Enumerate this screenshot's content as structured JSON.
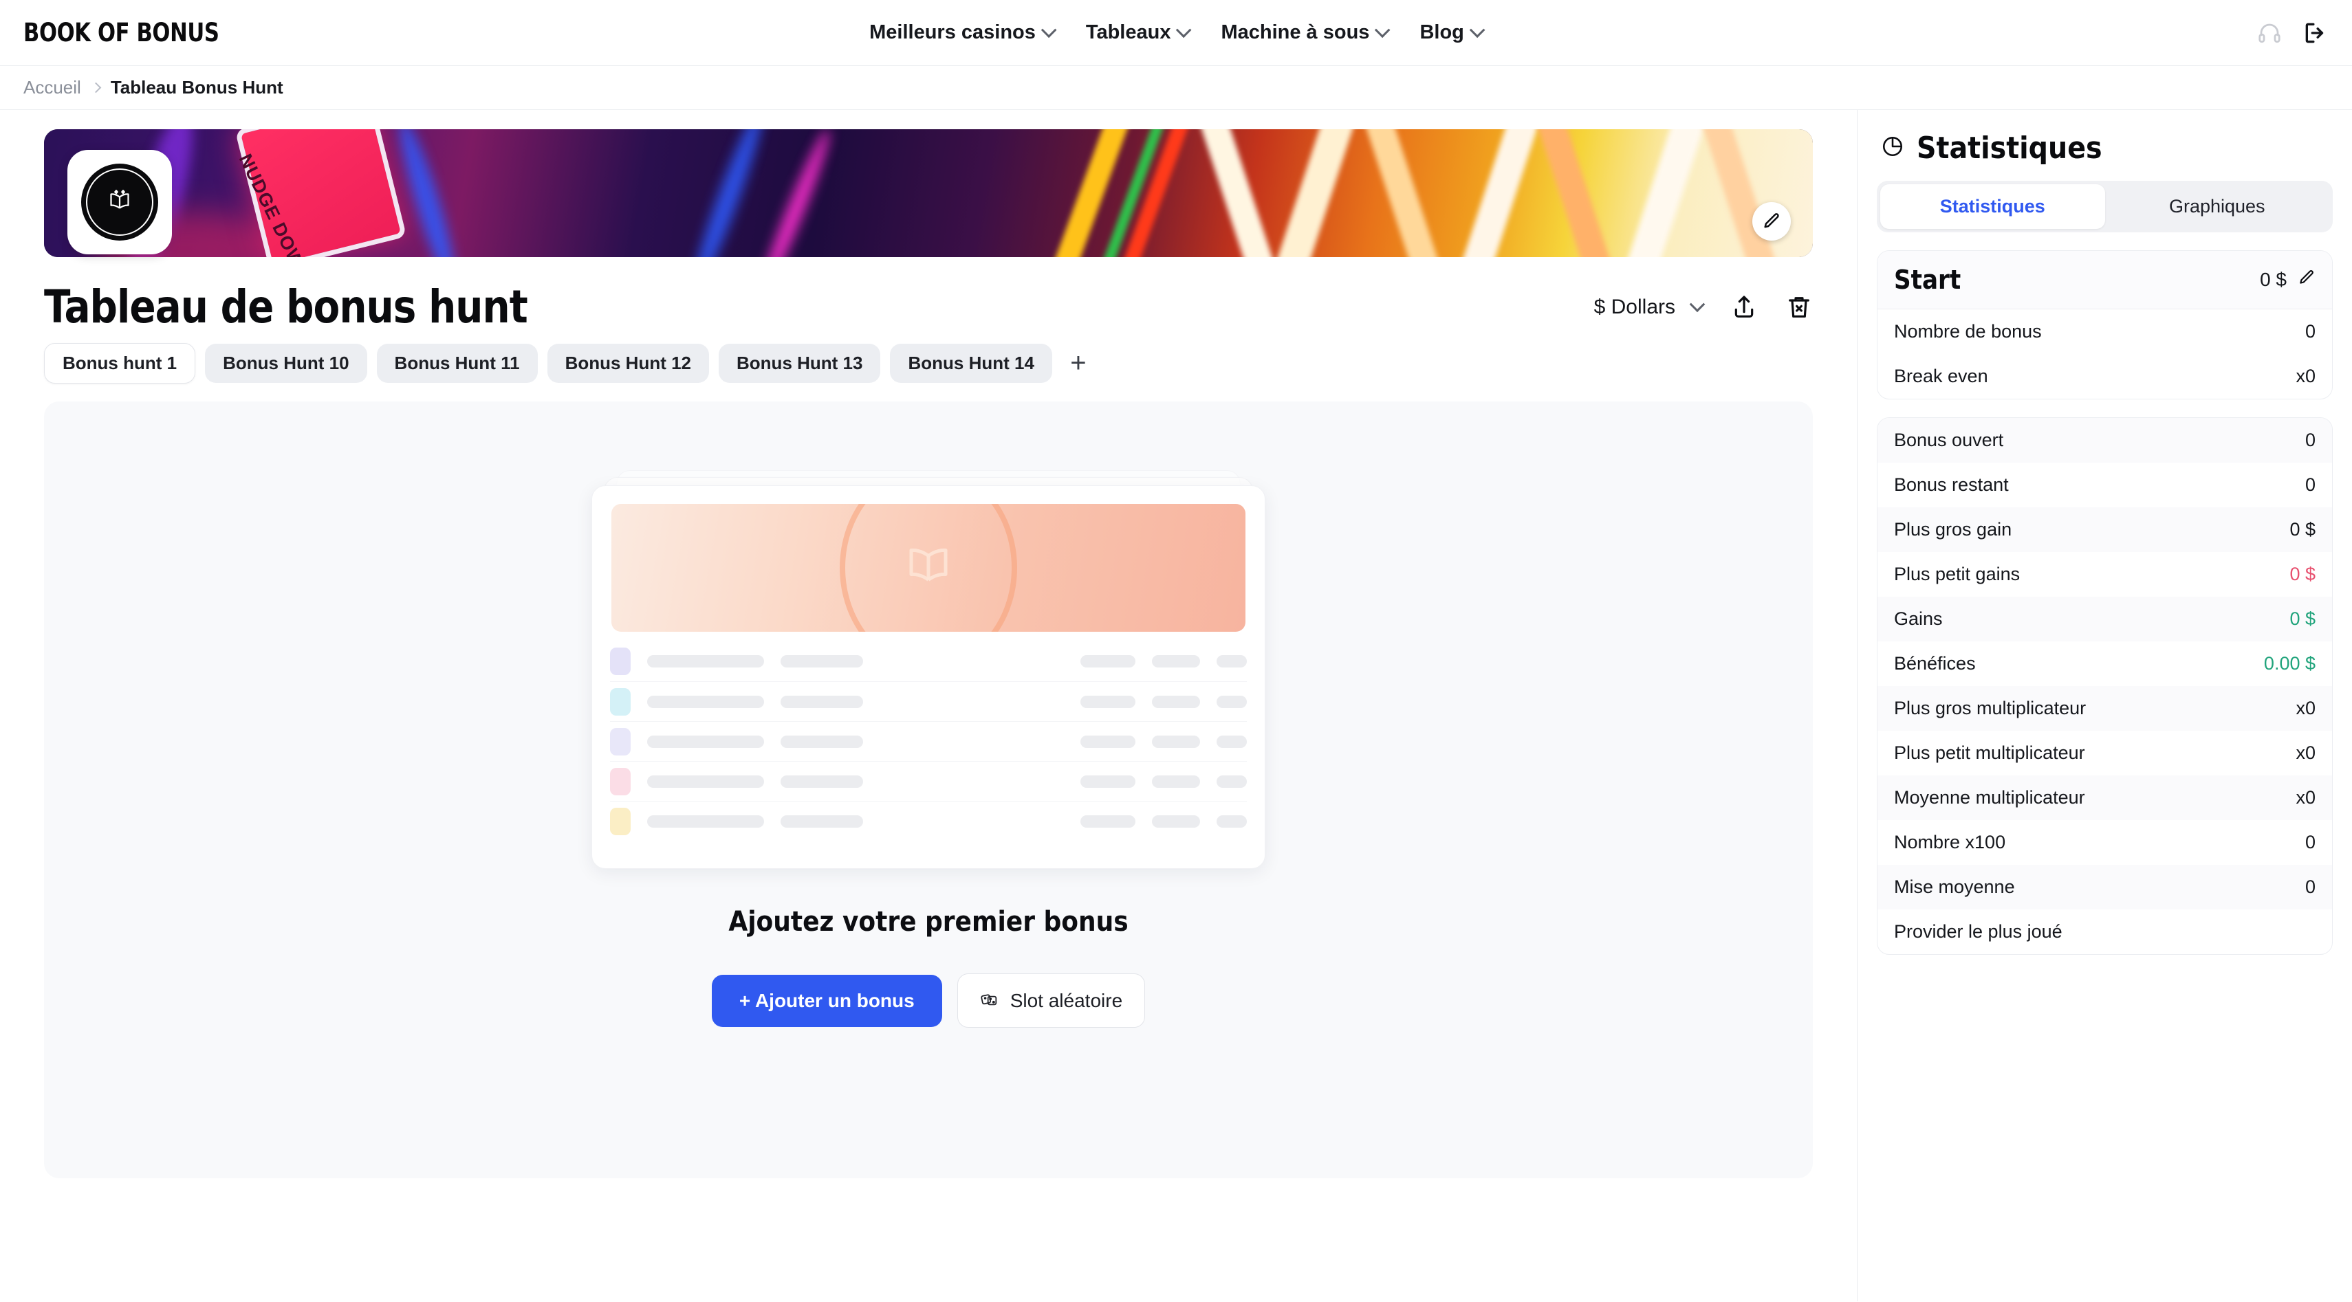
{
  "header": {
    "logo": "BOOK OF BONUS",
    "nav": [
      {
        "label": "Meilleurs casinos"
      },
      {
        "label": "Tableaux"
      },
      {
        "label": "Machine à sous"
      },
      {
        "label": "Blog"
      }
    ],
    "support_icon": "headphones-icon",
    "logout_icon": "logout-icon"
  },
  "breadcrumb": {
    "home": "Accueil",
    "current": "Tableau Bonus Hunt"
  },
  "banner": {
    "sign_text": "NUDGE DOWN",
    "edit_icon": "pencil-icon",
    "avatar_icon": "book-of-bonus-badge"
  },
  "main": {
    "title": "Tableau de bonus hunt",
    "currency": {
      "label": "$ Dollars",
      "caret_icon": "chevron-down-icon"
    },
    "share_icon": "upload-icon",
    "delete_icon": "trash-x-icon",
    "tabs": [
      {
        "label": "Bonus hunt 1",
        "active": true
      },
      {
        "label": "Bonus Hunt 10",
        "active": false
      },
      {
        "label": "Bonus Hunt 11",
        "active": false
      },
      {
        "label": "Bonus Hunt 12",
        "active": false
      },
      {
        "label": "Bonus Hunt 13",
        "active": false
      },
      {
        "label": "Bonus Hunt 14",
        "active": false
      }
    ],
    "tab_add_label": "+",
    "empty": {
      "title": "Ajoutez votre premier bonus",
      "primary_button": "+ Ajouter un bonus",
      "secondary_button": "Slot aléatoire",
      "secondary_icon": "dice-icon",
      "skeleton_chip_colors": [
        "#e4e2f8",
        "#d4f1f7",
        "#e8e7f9",
        "#fbdde6",
        "#fbeec5"
      ]
    }
  },
  "stats": {
    "panel_icon": "pie-chart-icon",
    "panel_title": "Statistiques",
    "tabs": [
      {
        "label": "Statistiques",
        "active": true
      },
      {
        "label": "Graphiques",
        "active": false
      }
    ],
    "start": {
      "label": "Start",
      "value": "0 $",
      "edit_icon": "pencil-icon"
    },
    "summary_rows": [
      {
        "label": "Nombre de bonus",
        "value": "0"
      },
      {
        "label": "Break even",
        "value": "x0"
      }
    ],
    "rows": [
      {
        "label": "Bonus ouvert",
        "value": "0",
        "tone": ""
      },
      {
        "label": "Bonus restant",
        "value": "0",
        "tone": ""
      },
      {
        "label": "Plus gros gain",
        "value": "0 $",
        "tone": ""
      },
      {
        "label": "Plus petit gains",
        "value": "0 $",
        "tone": "red"
      },
      {
        "label": "Gains",
        "value": "0 $",
        "tone": "green"
      },
      {
        "label": "Bénéfices",
        "value": "0.00 $",
        "tone": "green"
      },
      {
        "label": "Plus gros multiplicateur",
        "value": "x0",
        "tone": ""
      },
      {
        "label": "Plus petit multiplicateur",
        "value": "x0",
        "tone": ""
      },
      {
        "label": "Moyenne multiplicateur",
        "value": "x0",
        "tone": ""
      },
      {
        "label": "Nombre x100",
        "value": "0",
        "tone": ""
      },
      {
        "label": "Mise moyenne",
        "value": "0",
        "tone": ""
      },
      {
        "label": "Provider le plus joué",
        "value": "",
        "tone": ""
      }
    ]
  },
  "colors": {
    "accent_blue": "#3059f0",
    "positive_green": "#21a47c",
    "negative_red": "#e8506f"
  }
}
